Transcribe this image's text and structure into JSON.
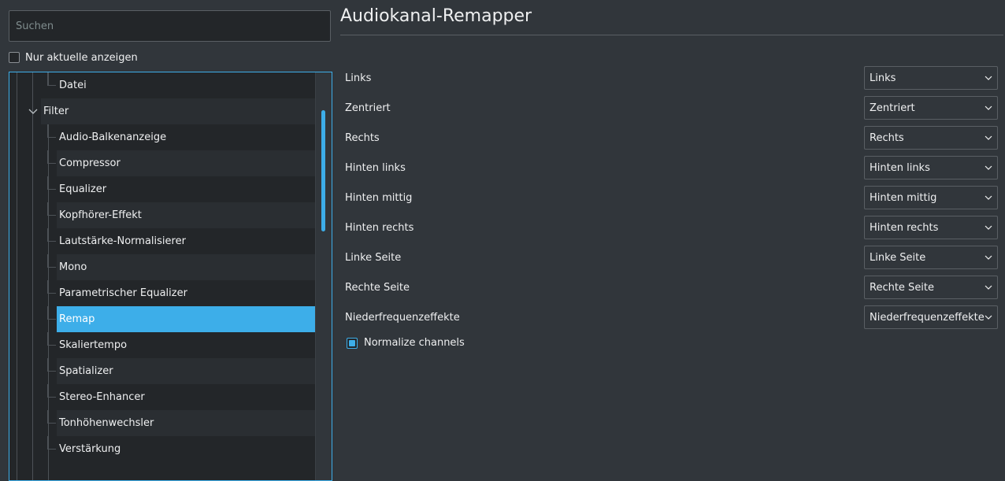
{
  "sidebar": {
    "search_placeholder": "Suchen",
    "current_only_label": "Nur aktuelle anzeigen",
    "current_only_checked": false,
    "tree": {
      "datei": "Datei",
      "filter": "Filter",
      "items": [
        "Audio-Balkenanzeige",
        "Compressor",
        "Equalizer",
        "Kopfhörer-Effekt",
        "Lautstärke-Normalisierer",
        "Mono",
        "Parametrischer Equalizer",
        "Remap",
        "Skaliertempo",
        "Spatializer",
        "Stereo-Enhancer",
        "Tonhöhenwechsler",
        "Verstärkung"
      ],
      "selected": "Remap"
    }
  },
  "main": {
    "title": "Audiokanal-Remapper",
    "channels": [
      {
        "label": "Links",
        "value": "Links"
      },
      {
        "label": "Zentriert",
        "value": "Zentriert"
      },
      {
        "label": "Rechts",
        "value": "Rechts"
      },
      {
        "label": "Hinten links",
        "value": "Hinten links"
      },
      {
        "label": "Hinten mittig",
        "value": "Hinten mittig"
      },
      {
        "label": "Hinten rechts",
        "value": "Hinten rechts"
      },
      {
        "label": "Linke Seite",
        "value": "Linke Seite"
      },
      {
        "label": "Rechte Seite",
        "value": "Rechte Seite"
      },
      {
        "label": "Niederfrequenzeffekte",
        "value": "Niederfrequenzeffekte"
      }
    ],
    "normalize_label": "Normalize channels",
    "normalize_checked": true
  },
  "colors": {
    "accent": "#3daee9",
    "background": "#31363b",
    "view_background": "#232629"
  }
}
